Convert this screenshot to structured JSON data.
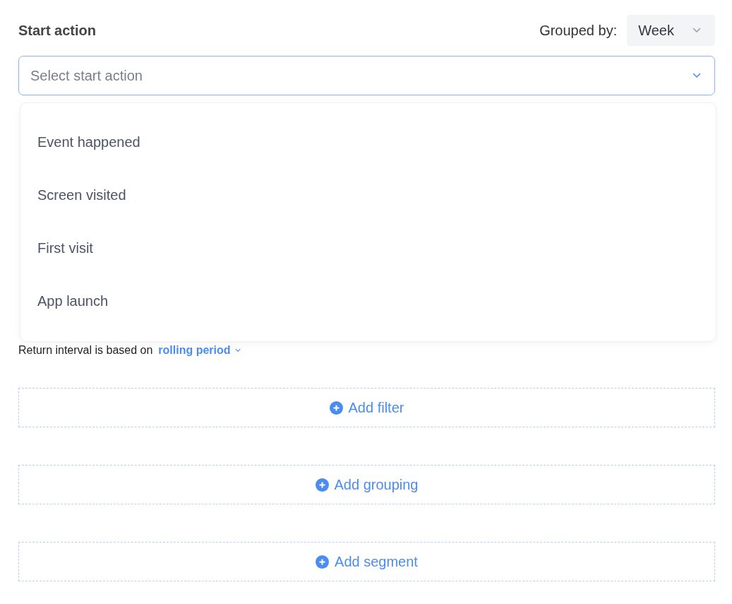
{
  "start_action": {
    "label": "Start action",
    "placeholder": "Select start action",
    "expanded": true
  },
  "grouped_by": {
    "label": "Grouped by:",
    "value": "Week"
  },
  "options": [
    {
      "label": "Event happened"
    },
    {
      "label": "Screen visited"
    },
    {
      "label": "First visit"
    },
    {
      "label": "App launch"
    }
  ],
  "return_interval": {
    "text": "Return interval is based on",
    "link": "rolling period"
  },
  "add_buttons": [
    {
      "label": "Add filter"
    },
    {
      "label": "Add grouping"
    },
    {
      "label": "Add segment"
    }
  ]
}
